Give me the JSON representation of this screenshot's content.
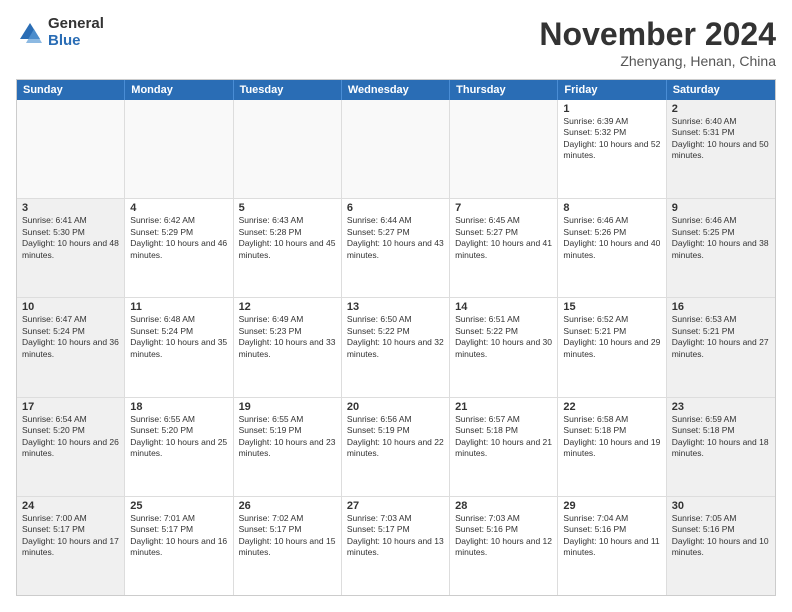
{
  "logo": {
    "general": "General",
    "blue": "Blue"
  },
  "title": "November 2024",
  "location": "Zhenyang, Henan, China",
  "weekdays": [
    "Sunday",
    "Monday",
    "Tuesday",
    "Wednesday",
    "Thursday",
    "Friday",
    "Saturday"
  ],
  "rows": [
    [
      {
        "day": "",
        "info": ""
      },
      {
        "day": "",
        "info": ""
      },
      {
        "day": "",
        "info": ""
      },
      {
        "day": "",
        "info": ""
      },
      {
        "day": "",
        "info": ""
      },
      {
        "day": "1",
        "info": "Sunrise: 6:39 AM\nSunset: 5:32 PM\nDaylight: 10 hours and 52 minutes."
      },
      {
        "day": "2",
        "info": "Sunrise: 6:40 AM\nSunset: 5:31 PM\nDaylight: 10 hours and 50 minutes."
      }
    ],
    [
      {
        "day": "3",
        "info": "Sunrise: 6:41 AM\nSunset: 5:30 PM\nDaylight: 10 hours and 48 minutes."
      },
      {
        "day": "4",
        "info": "Sunrise: 6:42 AM\nSunset: 5:29 PM\nDaylight: 10 hours and 46 minutes."
      },
      {
        "day": "5",
        "info": "Sunrise: 6:43 AM\nSunset: 5:28 PM\nDaylight: 10 hours and 45 minutes."
      },
      {
        "day": "6",
        "info": "Sunrise: 6:44 AM\nSunset: 5:27 PM\nDaylight: 10 hours and 43 minutes."
      },
      {
        "day": "7",
        "info": "Sunrise: 6:45 AM\nSunset: 5:27 PM\nDaylight: 10 hours and 41 minutes."
      },
      {
        "day": "8",
        "info": "Sunrise: 6:46 AM\nSunset: 5:26 PM\nDaylight: 10 hours and 40 minutes."
      },
      {
        "day": "9",
        "info": "Sunrise: 6:46 AM\nSunset: 5:25 PM\nDaylight: 10 hours and 38 minutes."
      }
    ],
    [
      {
        "day": "10",
        "info": "Sunrise: 6:47 AM\nSunset: 5:24 PM\nDaylight: 10 hours and 36 minutes."
      },
      {
        "day": "11",
        "info": "Sunrise: 6:48 AM\nSunset: 5:24 PM\nDaylight: 10 hours and 35 minutes."
      },
      {
        "day": "12",
        "info": "Sunrise: 6:49 AM\nSunset: 5:23 PM\nDaylight: 10 hours and 33 minutes."
      },
      {
        "day": "13",
        "info": "Sunrise: 6:50 AM\nSunset: 5:22 PM\nDaylight: 10 hours and 32 minutes."
      },
      {
        "day": "14",
        "info": "Sunrise: 6:51 AM\nSunset: 5:22 PM\nDaylight: 10 hours and 30 minutes."
      },
      {
        "day": "15",
        "info": "Sunrise: 6:52 AM\nSunset: 5:21 PM\nDaylight: 10 hours and 29 minutes."
      },
      {
        "day": "16",
        "info": "Sunrise: 6:53 AM\nSunset: 5:21 PM\nDaylight: 10 hours and 27 minutes."
      }
    ],
    [
      {
        "day": "17",
        "info": "Sunrise: 6:54 AM\nSunset: 5:20 PM\nDaylight: 10 hours and 26 minutes."
      },
      {
        "day": "18",
        "info": "Sunrise: 6:55 AM\nSunset: 5:20 PM\nDaylight: 10 hours and 25 minutes."
      },
      {
        "day": "19",
        "info": "Sunrise: 6:55 AM\nSunset: 5:19 PM\nDaylight: 10 hours and 23 minutes."
      },
      {
        "day": "20",
        "info": "Sunrise: 6:56 AM\nSunset: 5:19 PM\nDaylight: 10 hours and 22 minutes."
      },
      {
        "day": "21",
        "info": "Sunrise: 6:57 AM\nSunset: 5:18 PM\nDaylight: 10 hours and 21 minutes."
      },
      {
        "day": "22",
        "info": "Sunrise: 6:58 AM\nSunset: 5:18 PM\nDaylight: 10 hours and 19 minutes."
      },
      {
        "day": "23",
        "info": "Sunrise: 6:59 AM\nSunset: 5:18 PM\nDaylight: 10 hours and 18 minutes."
      }
    ],
    [
      {
        "day": "24",
        "info": "Sunrise: 7:00 AM\nSunset: 5:17 PM\nDaylight: 10 hours and 17 minutes."
      },
      {
        "day": "25",
        "info": "Sunrise: 7:01 AM\nSunset: 5:17 PM\nDaylight: 10 hours and 16 minutes."
      },
      {
        "day": "26",
        "info": "Sunrise: 7:02 AM\nSunset: 5:17 PM\nDaylight: 10 hours and 15 minutes."
      },
      {
        "day": "27",
        "info": "Sunrise: 7:03 AM\nSunset: 5:17 PM\nDaylight: 10 hours and 13 minutes."
      },
      {
        "day": "28",
        "info": "Sunrise: 7:03 AM\nSunset: 5:16 PM\nDaylight: 10 hours and 12 minutes."
      },
      {
        "day": "29",
        "info": "Sunrise: 7:04 AM\nSunset: 5:16 PM\nDaylight: 10 hours and 11 minutes."
      },
      {
        "day": "30",
        "info": "Sunrise: 7:05 AM\nSunset: 5:16 PM\nDaylight: 10 hours and 10 minutes."
      }
    ]
  ]
}
